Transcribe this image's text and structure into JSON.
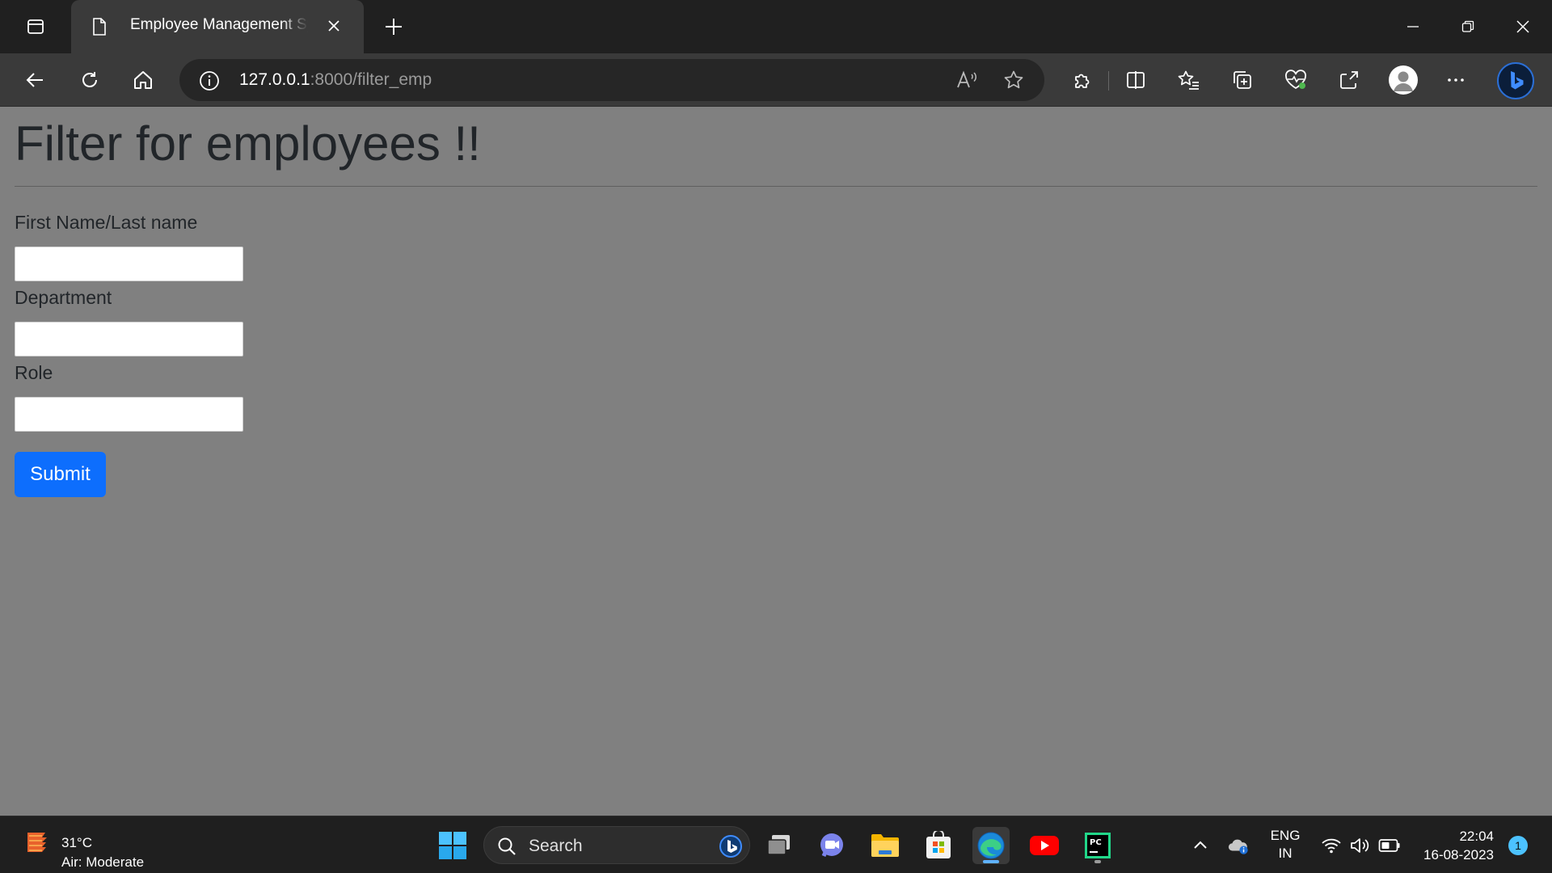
{
  "browser": {
    "tab_title": "Employee Management System",
    "url_host": "127.0.0.1",
    "url_path": ":8000/filter_emp"
  },
  "page": {
    "title": "Filter for employees !!",
    "fields": [
      {
        "label": "First Name/Last name",
        "value": ""
      },
      {
        "label": "Department",
        "value": ""
      },
      {
        "label": "Role",
        "value": ""
      }
    ],
    "submit_label": "Submit"
  },
  "taskbar": {
    "weather_temp": "31°C",
    "weather_desc": "Air: Moderate",
    "search_placeholder": "Search",
    "lang_line1": "ENG",
    "lang_line2": "IN",
    "time": "22:04",
    "date": "16-08-2023",
    "notification_count": "1"
  },
  "colors": {
    "accent": "#0d6efd",
    "page_background": "#808080",
    "chrome_dark": "#202020",
    "toolbar": "#3a3a3a"
  }
}
